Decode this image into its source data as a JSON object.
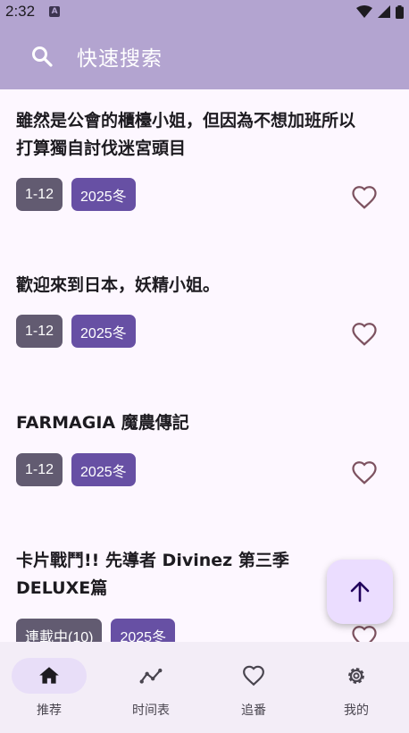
{
  "status_bar": {
    "time": "2:32",
    "notification_icon": "a-icon"
  },
  "search": {
    "placeholder": "快速搜索",
    "icon": "search-icon"
  },
  "anime_list": [
    {
      "title": "雖然是公會的櫃檯小姐，但因為不想加班所以打算獨自討伐迷宮頭目",
      "episodes": "1-12",
      "season": "2025冬",
      "favorite": false
    },
    {
      "title": "歡迎來到日本，妖精小姐。",
      "episodes": "1-12",
      "season": "2025冬",
      "favorite": false
    },
    {
      "title": "FARMAGIA 魔農傳記",
      "episodes": "1-12",
      "season": "2025冬",
      "favorite": false
    },
    {
      "title": "卡片戰鬥!! 先導者 Divinez 第三季 DELUXE篇",
      "episodes": "連載中(10)",
      "season": "2025冬",
      "favorite": false
    }
  ],
  "fab": {
    "icon": "arrow-up-icon"
  },
  "bottom_nav": [
    {
      "label": "推荐",
      "icon": "home-icon",
      "active": true
    },
    {
      "label": "时间表",
      "icon": "timeline-icon",
      "active": false
    },
    {
      "label": "追番",
      "icon": "heart-icon",
      "active": false
    },
    {
      "label": "我的",
      "icon": "settings-icon",
      "active": false
    }
  ],
  "colors": {
    "header": "#b3a4d0",
    "background": "#fdf7ff",
    "episode_tag": "#625b71",
    "season_tag": "#6750a4",
    "heart": "#7d5260",
    "fab": "#ebddff"
  }
}
